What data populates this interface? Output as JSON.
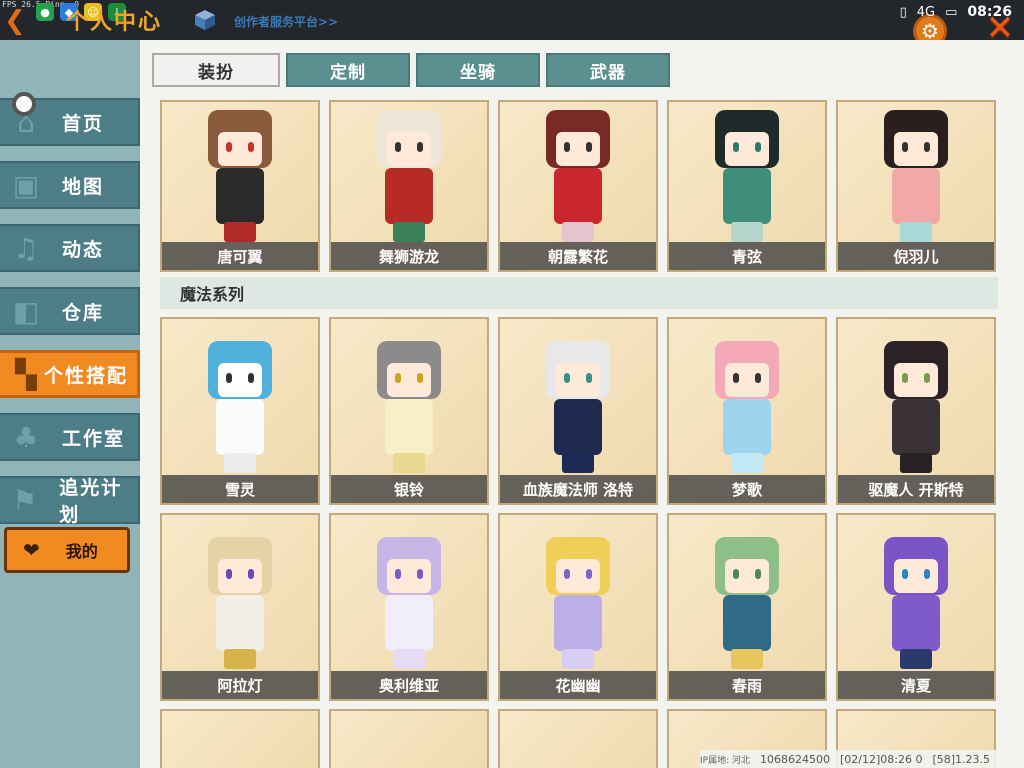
{
  "status_bar": {
    "fps": "FPS 26.5",
    "ping": "Ping: 0",
    "network": "4G",
    "time": "08:26"
  },
  "header": {
    "title": "个人中心",
    "creator_link": "创作者服务平台>>"
  },
  "sidebar": {
    "items": [
      {
        "label": "首页",
        "icon": "home-icon"
      },
      {
        "label": "地图",
        "icon": "map-icon"
      },
      {
        "label": "动态",
        "icon": "bell-icon"
      },
      {
        "label": "仓库",
        "icon": "box-icon"
      },
      {
        "label": "个性搭配",
        "icon": "outfit-icon",
        "active": true
      },
      {
        "label": "工作室",
        "icon": "tree-icon"
      },
      {
        "label": "追光计划",
        "icon": "flag-icon"
      }
    ],
    "mine_label": "我的"
  },
  "tabs": [
    {
      "label": "装扮",
      "active": true
    },
    {
      "label": "定制"
    },
    {
      "label": "坐骑"
    },
    {
      "label": "武器"
    }
  ],
  "row1": [
    "唐可翼",
    "舞狮游龙",
    "朝露繁花",
    "青弦",
    "倪羽儿"
  ],
  "section_title": "魔法系列",
  "row2": [
    "雪灵",
    "银铃",
    "血族魔法师 洛特",
    "梦歌",
    "驱魔人 开斯特"
  ],
  "row3": [
    "阿拉灯",
    "奥利维亚",
    "花幽幽",
    "春雨",
    "清夏"
  ],
  "footer": {
    "ip_label": "IP属地: 河北",
    "uid": "1068624500",
    "timestamp": "[02/12]08:26 0",
    "version": "[58]1.23.5"
  },
  "colors": {
    "sidebar_bg": "#8fb5b9",
    "sidebar_item": "#4d7e87",
    "accent_orange": "#f18a21",
    "tab_teal": "#5c9090"
  }
}
